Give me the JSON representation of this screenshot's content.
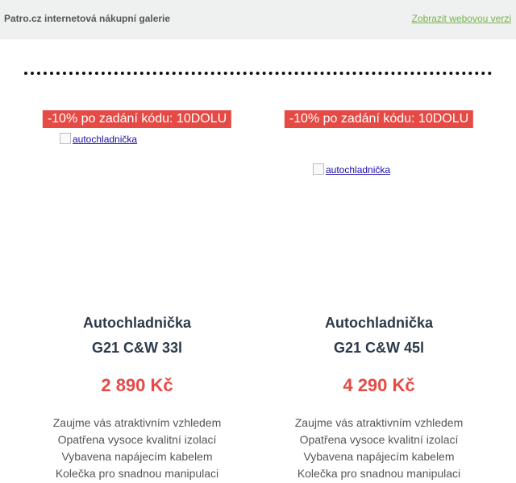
{
  "header": {
    "brand": "Patro.cz internetová nákupní galerie",
    "web_version_link": "Zobrazit webovou verzi"
  },
  "products": [
    {
      "badge": "-10% po zadání kódu: 10DOLU",
      "image_alt": "autochladnička",
      "name_line1": "Autochladnička",
      "name_line2": "G21 C&W 33l",
      "price": "2 890 Kč",
      "features": [
        "Zaujme vás atraktivním vzhledem",
        "Opatřena vysoce kvalitní izolací",
        "Vybavena napájecím kabelem",
        "Kolečka pro snadnou manipulaci"
      ]
    },
    {
      "badge": "-10% po zadání kódu: 10DOLU",
      "image_alt": "autochladnička",
      "name_line1": "Autochladnička",
      "name_line2": "G21 C&W 45l",
      "price": "4 290 Kč",
      "features": [
        "Zaujme vás atraktivním vzhledem",
        "Opatřena vysoce kvalitní izolací",
        "Vybavena napájecím kabelem",
        "Kolečka pro snadnou manipulaci"
      ]
    }
  ]
}
